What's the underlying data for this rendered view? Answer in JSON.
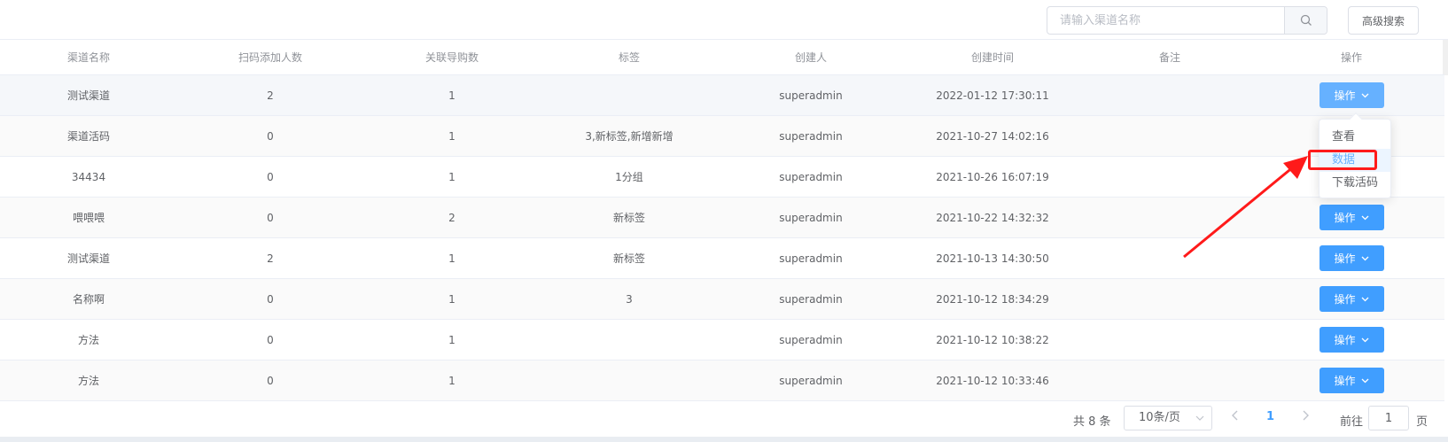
{
  "toolbar": {
    "search_placeholder": "请输入渠道名称",
    "advanced_search_label": "高级搜索"
  },
  "table": {
    "headers": [
      "渠道名称",
      "扫码添加人数",
      "关联导购数",
      "标签",
      "创建人",
      "创建时间",
      "备注",
      "操作"
    ],
    "rows": [
      {
        "name": "测试渠道",
        "scan_count": "2",
        "guide_count": "1",
        "tags": "",
        "creator": "superadmin",
        "created_at": "2022-01-12 17:30:11",
        "remark": "",
        "action": "操作"
      },
      {
        "name": "渠道活码",
        "scan_count": "0",
        "guide_count": "1",
        "tags": "3,新标签,新增新增",
        "creator": "superadmin",
        "created_at": "2021-10-27 14:02:16",
        "remark": "",
        "action": ""
      },
      {
        "name": "34434",
        "scan_count": "0",
        "guide_count": "1",
        "tags": "1分组",
        "creator": "superadmin",
        "created_at": "2021-10-26 16:07:19",
        "remark": "",
        "action": ""
      },
      {
        "name": "喂喂喂",
        "scan_count": "0",
        "guide_count": "2",
        "tags": "新标签",
        "creator": "superadmin",
        "created_at": "2021-10-22 14:32:32",
        "remark": "",
        "action": "操作"
      },
      {
        "name": "测试渠道",
        "scan_count": "2",
        "guide_count": "1",
        "tags": "新标签",
        "creator": "superadmin",
        "created_at": "2021-10-13 14:30:50",
        "remark": "",
        "action": "操作"
      },
      {
        "name": "名称啊",
        "scan_count": "0",
        "guide_count": "1",
        "tags": "3",
        "creator": "superadmin",
        "created_at": "2021-10-12 18:34:29",
        "remark": "",
        "action": "操作"
      },
      {
        "name": "方法",
        "scan_count": "0",
        "guide_count": "1",
        "tags": "",
        "creator": "superadmin",
        "created_at": "2021-10-12 10:38:22",
        "remark": "",
        "action": "操作"
      },
      {
        "name": "方法",
        "scan_count": "0",
        "guide_count": "1",
        "tags": "",
        "creator": "superadmin",
        "created_at": "2021-10-12 10:33:46",
        "remark": "",
        "action": "操作"
      }
    ]
  },
  "dropdown": {
    "items": [
      "查看",
      "数据",
      "下载活码"
    ],
    "active_index": 1
  },
  "pagination": {
    "total_label": "共 8 条",
    "page_size": "10条/页",
    "current_page": "1",
    "goto_label": "前往",
    "goto_value": "1",
    "page_unit": "页"
  },
  "colors": {
    "primary": "#409eff",
    "primary_light": "#66b1ff",
    "annotation": "#ff1a1a"
  }
}
